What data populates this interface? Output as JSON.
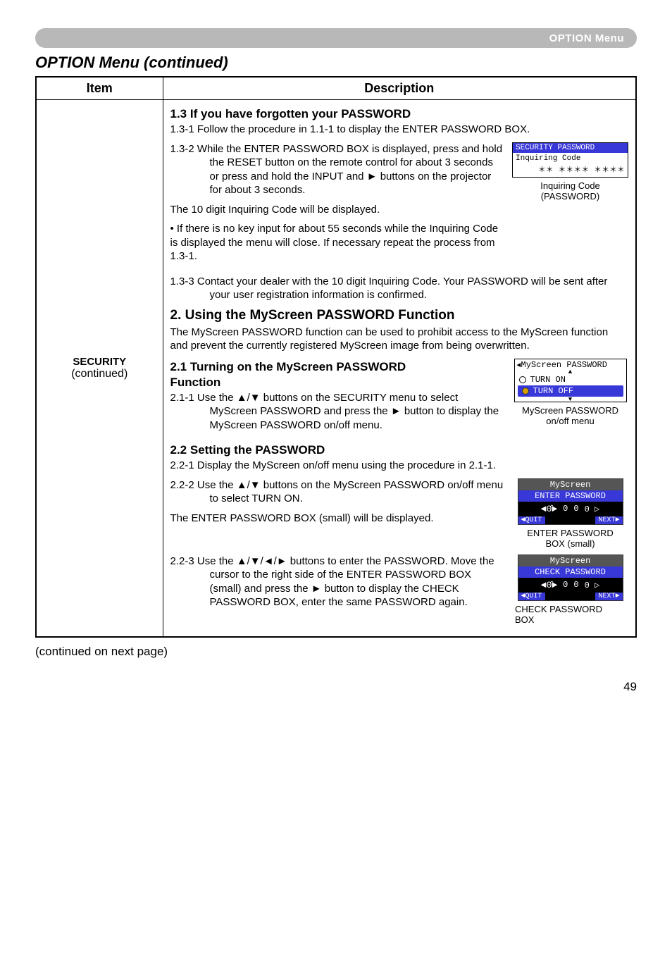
{
  "header": {
    "menu_label": "OPTION Menu"
  },
  "section_title": "OPTION Menu (continued)",
  "table": {
    "head_item": "Item",
    "head_desc": "Description",
    "item_label": "SECURITY",
    "item_sub": "(continued)"
  },
  "s13": {
    "heading": "1.3 If you have forgotten your PASSWORD",
    "p1": "1.3-1 Follow the procedure in 1.1-1 to display the ENTER PASSWORD BOX.",
    "p2a": "1.3-2 While the ENTER PASSWORD BOX is displayed, press and hold the RESET button on the remote control for about 3 seconds or press and hold the INPUT and ► buttons on the projector for about 3 seconds.",
    "p2b": "The 10 digit Inquiring Code will be displayed.",
    "p2c": "• If there is no key input for about 55 seconds while the Inquiring Code is displayed the menu will close. If necessary repeat the process from 1.3-1.",
    "p3": "1.3-3 Contact your dealer with the 10 digit Inquiring Code. Your PASSWORD will be sent after your user registration information is confirmed."
  },
  "inquiry_box": {
    "title": "SECURITY PASSWORD",
    "line1": "Inquiring Code",
    "line2": "＊＊ ＊＊＊＊ ＊＊＊＊",
    "caption1": "Inquiring Code",
    "caption2": "(PASSWORD)"
  },
  "s2": {
    "heading": "2. Using the MyScreen PASSWORD Function",
    "intro": "The MyScreen PASSWORD function can be used to prohibit access to the MyScreen function and prevent the currently registered MyScreen image from being overwritten.",
    "h21a": "2.1 Turning on the MyScreen PASSWORD",
    "h21b": "Function",
    "p211": "2.1-1 Use the ▲/▼ buttons on the SECURITY menu to select MyScreen PASSWORD and press the ► button to display the MyScreen PASSWORD on/off menu."
  },
  "onoff": {
    "hdr": "MyScreen PASSWORD",
    "on": "TURN ON",
    "off": "TURN OFF",
    "caption1": "MyScreen PASSWORD",
    "caption2": "on/off menu"
  },
  "s22": {
    "heading": "2.2 Setting the PASSWORD",
    "p221": "2.2-1 Display the MyScreen on/off menu using the procedure in 2.1-1.",
    "p222a": "2.2-2 Use the ▲/▼ buttons on the MyScreen PASSWORD on/off menu to select TURN ON.",
    "p222b": "The ENTER PASSWORD BOX (small) will be displayed.",
    "p223": "2.2-3 Use the ▲/▼/◄/► buttons to enter the PASSWORD. Move the cursor to the right side of the ENTER PASSWORD BOX (small) and press the ► button to display the CHECK PASSWORD BOX, enter the same PASSWORD again."
  },
  "enter_pw": {
    "hdr1": "MyScreen",
    "hdr2": "ENTER PASSWORD",
    "quit": "◄QUIT",
    "next": "NEXT►",
    "caption1": "ENTER PASSWORD",
    "caption2": "BOX (small)"
  },
  "check_pw": {
    "hdr1": "MyScreen",
    "hdr2": "CHECK PASSWORD",
    "caption1": "CHECK PASSWORD",
    "caption2": "BOX"
  },
  "footer_note": "(continued on next page)",
  "page_num": "49"
}
